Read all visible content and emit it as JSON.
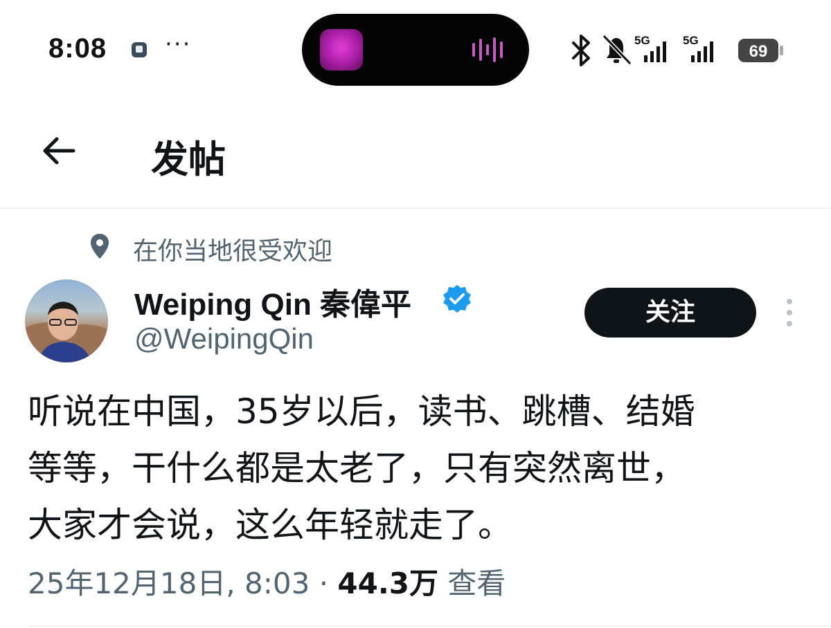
{
  "status_bar": {
    "time": "8:08",
    "overflow": "···",
    "network_1": "5G",
    "network_2": "5G",
    "battery_level": "69",
    "icons": [
      "app-notification-icon",
      "bluetooth-icon",
      "bell-off-icon",
      "signal-icon",
      "battery-icon"
    ]
  },
  "header": {
    "back_icon": "arrow-left-icon",
    "title": "发帖"
  },
  "context": {
    "icon": "location-pin-icon",
    "text": "在你当地很受欢迎"
  },
  "author": {
    "display_name": "Weiping Qin 秦偉平",
    "handle": "@WeipingQin",
    "verified": true,
    "verified_color": "#1d9bf0"
  },
  "actions": {
    "follow_label": "关注",
    "more_icon": "more-vertical-icon"
  },
  "post": {
    "text": "听说在中国，35岁以后，读书、跳槽、结婚\n等等，干什么都是太老了，只有突然离世，\n大家才会说，这么年轻就走了。",
    "timestamp": "25年12月18日, 8:03 · ",
    "views_count": "44.3万",
    "views_label": " 查看"
  },
  "colors": {
    "primary_text": "#0f1419",
    "secondary_text": "#536471",
    "divider": "#eff3f4",
    "follow_bg": "#0f1419",
    "verified": "#1d9bf0"
  }
}
